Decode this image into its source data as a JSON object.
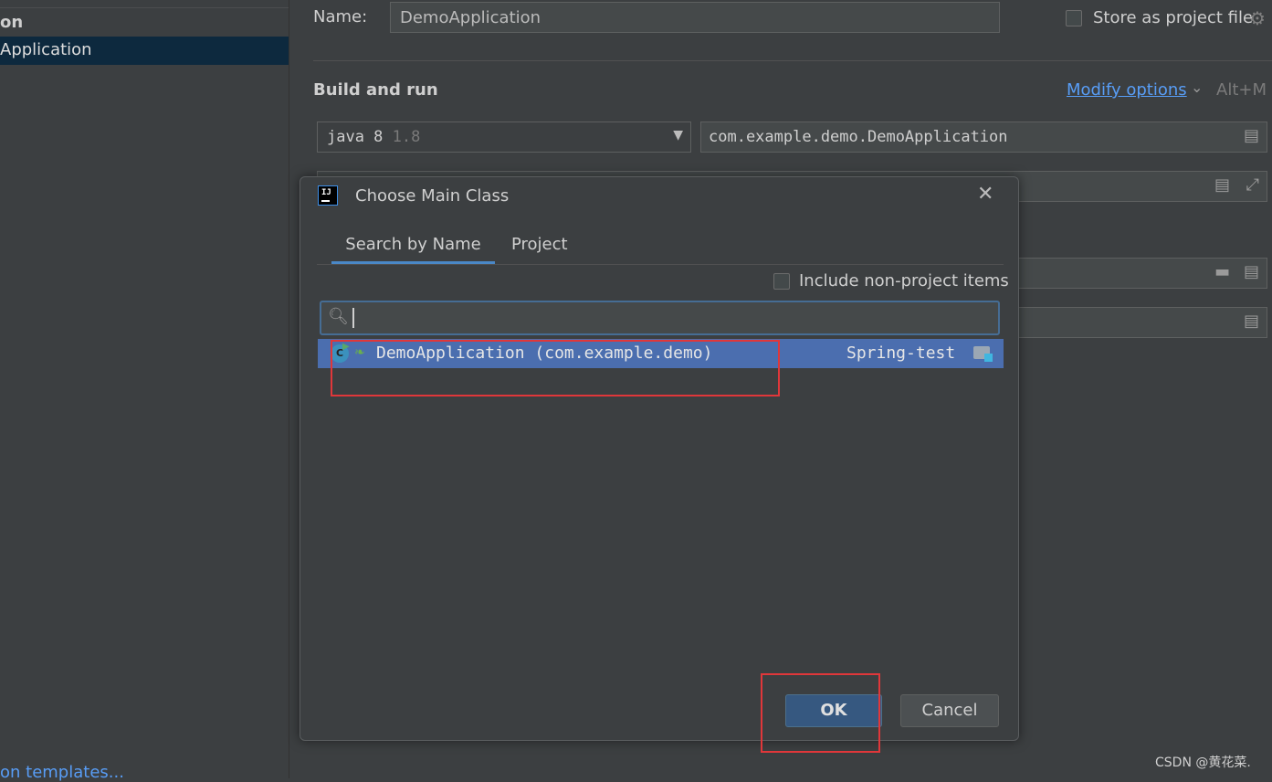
{
  "sidebar": {
    "group_label": "on",
    "selected_item": "Application",
    "templates_link": "on templates..."
  },
  "form": {
    "name_label": "Name:",
    "name_value": "DemoApplication",
    "store_label": "Store as project file",
    "store_checked": false,
    "build_title": "Build and run",
    "modify_options": "Modify options",
    "modify_shortcut": "Alt+M",
    "jdk_name": "java 8",
    "jdk_version": "1.8",
    "main_class": "com.example.demo.DemoApplication"
  },
  "dialog": {
    "title": "Choose Main Class",
    "tabs": [
      {
        "label": "Search by Name",
        "active": true
      },
      {
        "label": "Project",
        "active": false
      }
    ],
    "include_label": "Include non-project items",
    "include_checked": false,
    "search_value": "",
    "results": [
      {
        "name": "DemoApplication (com.example.demo)",
        "module": "Spring-test",
        "selected": true
      }
    ],
    "ok_label": "OK",
    "cancel_label": "Cancel"
  },
  "icons": {
    "gear": "gear-icon",
    "dropdown": "chevron-down-icon",
    "document": "document-icon",
    "expand": "expand-icon",
    "folder": "folder-icon",
    "search": "search-icon",
    "close": "close-icon",
    "class": "class-icon",
    "module": "module-folder-icon",
    "app_logo": "intellij-logo-icon"
  },
  "colors": {
    "background": "#3c3f41",
    "selection": "#4b6eaf",
    "link": "#589df6",
    "primary_button": "#365880",
    "annotation": "#e0373a"
  },
  "watermark": "CSDN @黄花菜."
}
